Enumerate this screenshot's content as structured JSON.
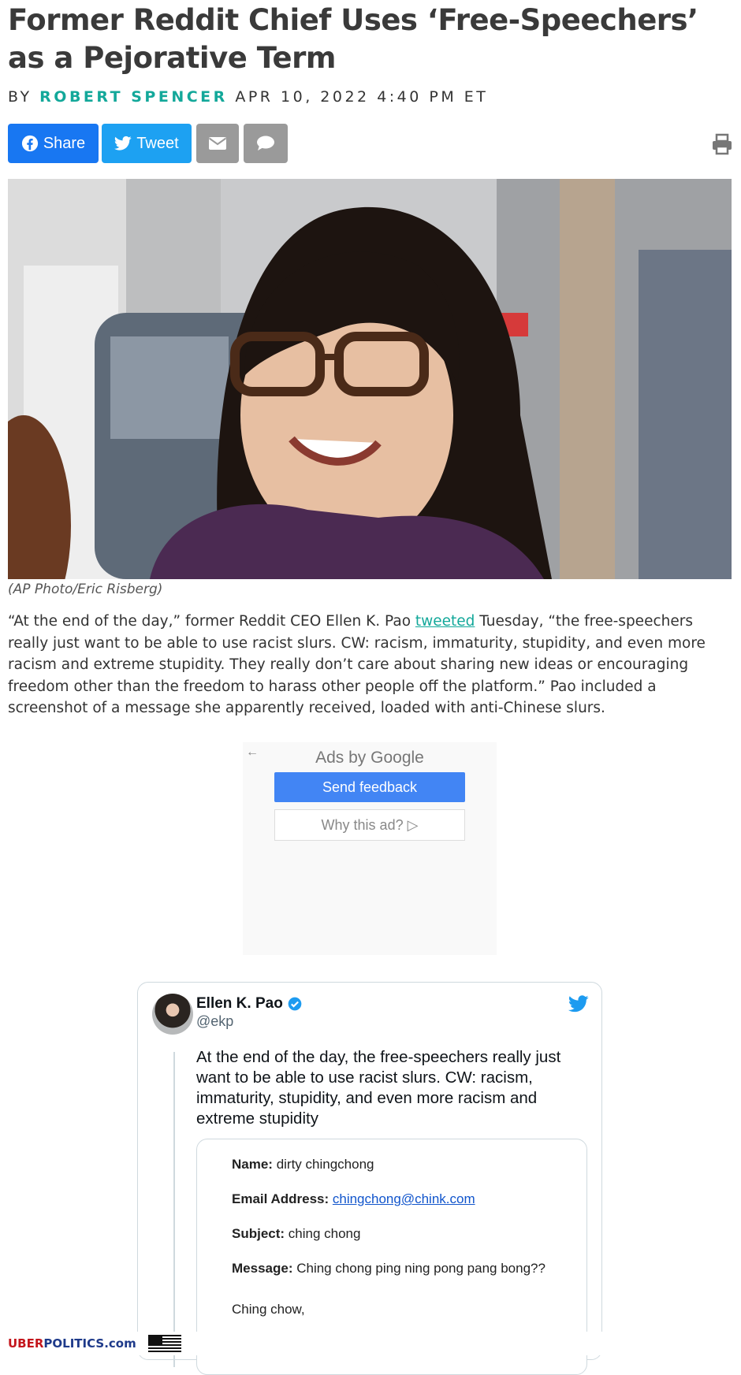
{
  "article": {
    "headline": "Former Reddit Chief Uses ‘Free-Speechers’ as a Pejorative Term",
    "byline_prefix": "BY",
    "author": "ROBERT SPENCER",
    "date": "APR 10, 2022 4:40 PM ET",
    "photo_caption": "(AP Photo/Eric Risberg)",
    "paragraph_before_link": "“At the end of the day,” former Reddit CEO Ellen K. Pao ",
    "paragraph_link": "tweeted",
    "paragraph_after_link": " Tuesday, “the free-speechers really just want to be able to use racist slurs. CW: racism, immaturity, stupidity, and even more racism and extreme stupidity. They really don’t care about sharing new ideas or encouraging freedom other than the freedom to harass other people off the platform.” Pao included a screenshot of a message she apparently received, loaded with anti-Chinese slurs."
  },
  "share": {
    "facebook_label": "Share",
    "twitter_label": "Tweet",
    "icons": [
      "facebook-icon",
      "twitter-icon",
      "envelope-icon",
      "chat-bubble-icon",
      "printer-icon"
    ]
  },
  "ad": {
    "back_arrow": "←",
    "ads_by": "Ads by Google",
    "send_feedback": "Send feedback",
    "why_this_ad": "Why this ad? ▷"
  },
  "tweet": {
    "name": "Ellen K. Pao",
    "handle": "@ekp",
    "text": "At the end of the day, the free-speechers really just want to be able to use racist slurs. CW: racism, immaturity, stupidity, and even more racism and extreme stupidity",
    "embed": {
      "name_label": "Name:",
      "name_value": " dirty chingchong",
      "email_label": "Email Address:",
      "email_value": "chingchong@chink.com",
      "subject_label": "Subject:",
      "subject_value": " ching chong",
      "message_label": "Message:",
      "message_value": " Ching chong ping ning pong pang bong??",
      "closing": "Ching chow,"
    }
  },
  "footer": {
    "brand_red": "UBER",
    "brand_blue": "POLITICS.com"
  },
  "colors": {
    "author_teal": "#13a89a",
    "facebook_blue": "#1877f2",
    "twitter_blue": "#1da1f2",
    "ad_button_blue": "#4285f4"
  }
}
